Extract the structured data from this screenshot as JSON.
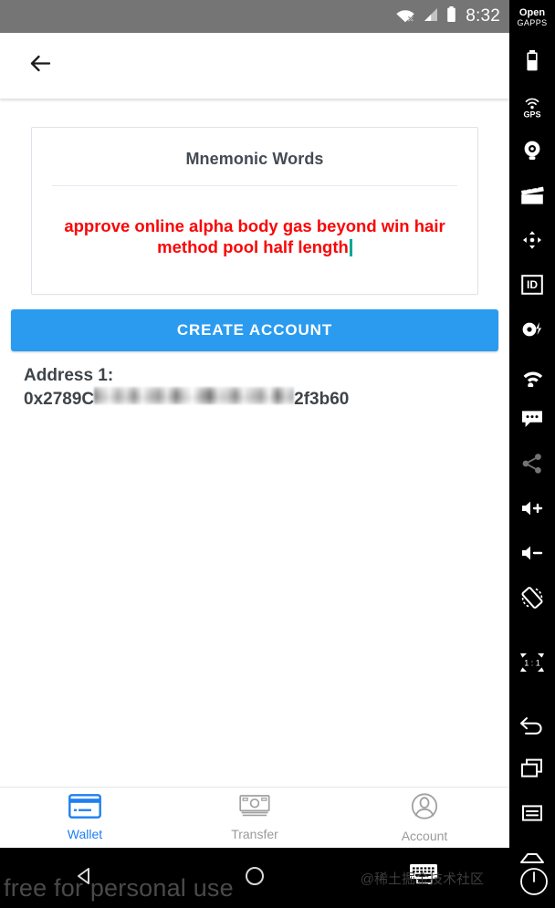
{
  "status_bar": {
    "time": "8:32",
    "icons": [
      "wifi-no-internet-icon",
      "cellular-signal-icon",
      "battery-icon"
    ],
    "background": "#757575"
  },
  "app_bar": {
    "back_icon": "back-arrow-icon"
  },
  "card": {
    "title": "Mnemonic Words",
    "mnemonic": "approve online alpha body gas beyond win hair method pool half length",
    "text_color": "#fa0505",
    "caret_color": "#00a896",
    "border_color": "#dde3ea"
  },
  "primary_button": {
    "label": "CREATE ACCOUNT",
    "color": "#2b9bf0"
  },
  "address": {
    "label": "Address 1:",
    "prefix": "0x2789C",
    "redacted": true,
    "suffix": "2f3b60"
  },
  "tab_bar": {
    "active": "Wallet",
    "active_color": "#1d7ff0",
    "inactive_color": "#9a9a9a",
    "items": [
      {
        "label": "Wallet",
        "icon": "credit-card-icon"
      },
      {
        "label": "Transfer",
        "icon": "banknote-icon"
      },
      {
        "label": "Account",
        "icon": "person-circle-icon"
      }
    ]
  },
  "nav_bar": {
    "items": [
      {
        "name": "back",
        "icon": "triangle-back-icon"
      },
      {
        "name": "home",
        "icon": "circle-home-icon"
      },
      {
        "name": "recents",
        "icon": "square-recents-icon"
      }
    ]
  },
  "watermarks": {
    "free_text": "free for personal use",
    "cn_text": "@稀土掘金技术社区",
    "keyboard_icon": "keyboard-icon"
  },
  "sidebar": {
    "logo_line1": "Open",
    "logo_line2": "GAPPS",
    "zoom_ratio": "1 : 1",
    "items": [
      {
        "name": "battery",
        "icon": "battery-icon"
      },
      {
        "name": "gps",
        "icon": "gps-icon",
        "label": "GPS"
      },
      {
        "name": "webcam",
        "icon": "webcam-icon"
      },
      {
        "name": "screen-record",
        "icon": "clapperboard-icon"
      },
      {
        "name": "dpad",
        "icon": "dpad-icon"
      },
      {
        "name": "identity",
        "icon": "id-badge-icon"
      },
      {
        "name": "power",
        "icon": "power-bolt-icon"
      },
      {
        "name": "cellular",
        "icon": "rss-signal-icon"
      },
      {
        "name": "sms",
        "icon": "sms-bubble-icon"
      },
      {
        "name": "share",
        "icon": "share-icon",
        "dim": true
      },
      {
        "name": "volume-up",
        "icon": "volume-up-icon"
      },
      {
        "name": "volume-down",
        "icon": "volume-down-icon"
      },
      {
        "name": "rotate",
        "icon": "rotate-icon"
      },
      {
        "name": "zoom-actual-size",
        "icon": "fit-ratio-icon"
      },
      {
        "name": "nav-back",
        "icon": "back-arrow-icon"
      },
      {
        "name": "nav-recents",
        "icon": "window-stack-icon"
      },
      {
        "name": "nav-menu",
        "icon": "menu-lines-icon"
      },
      {
        "name": "nav-home",
        "icon": "home-outline-icon"
      }
    ],
    "power_button_icon": "power-icon"
  }
}
